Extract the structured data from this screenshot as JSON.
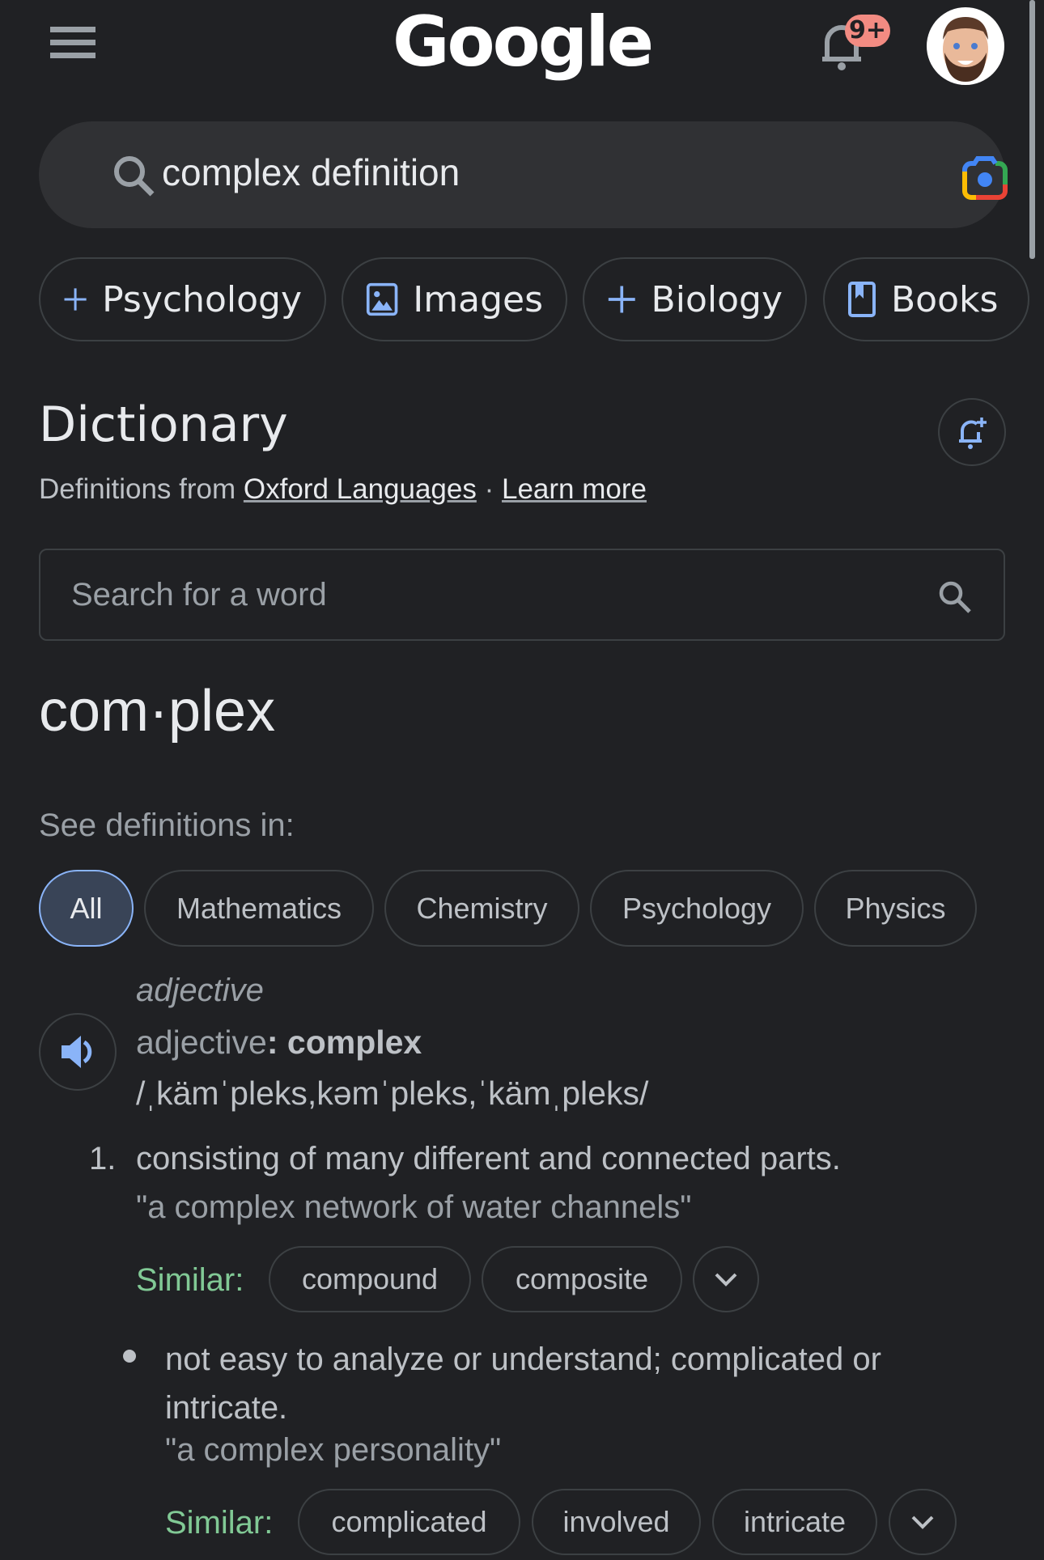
{
  "header": {
    "logo": "Google",
    "notification_badge": "9+",
    "icons": {
      "menu": "hamburger-icon",
      "notifications": "bell-icon",
      "account": "avatar"
    }
  },
  "search": {
    "query": "complex definition",
    "icons": {
      "search": "search-icon",
      "lens": "google-lens-icon"
    }
  },
  "chips": [
    {
      "label": "Psychology",
      "icon": "plus-icon"
    },
    {
      "label": "Images",
      "icon": "image-icon"
    },
    {
      "label": "Biology",
      "icon": "plus-icon"
    },
    {
      "label": "Books",
      "icon": "book-icon"
    }
  ],
  "dictionary": {
    "title": "Dictionary",
    "source_prefix": "Definitions from",
    "source_link": "Oxford Languages",
    "separator": "·",
    "learn_more": "Learn more",
    "word_search_placeholder": "Search for a word",
    "headword": "com·plex",
    "see_definitions_label": "See definitions in:",
    "domains": [
      {
        "label": "All",
        "active": true
      },
      {
        "label": "Mathematics",
        "active": false
      },
      {
        "label": "Chemistry",
        "active": false
      },
      {
        "label": "Psychology",
        "active": false
      },
      {
        "label": "Physics",
        "active": false
      }
    ],
    "part_of_speech": "adjective",
    "pos_label": "adjective",
    "pos_colon": ":",
    "pos_word": "complex",
    "pronunciation": "/ˌkämˈpleks,kəmˈpleks,ˈkämˌpleks/",
    "senses": [
      {
        "number": "1.",
        "definition": "consisting of many different and connected parts.",
        "example": "\"a complex network of water channels\"",
        "similar_label": "Similar:",
        "similar": [
          "compound",
          "composite"
        ]
      }
    ],
    "subsenses": [
      {
        "definition": "not easy to analyze or understand; complicated or intricate.",
        "example": "\"a complex personality\"",
        "similar_label": "Similar:",
        "similar": [
          "complicated",
          "involved",
          "intricate"
        ]
      }
    ]
  },
  "colors": {
    "background": "#202124",
    "accent_blue": "#8ab4f8",
    "similar_green": "#81c995",
    "badge": "#f28b82"
  }
}
